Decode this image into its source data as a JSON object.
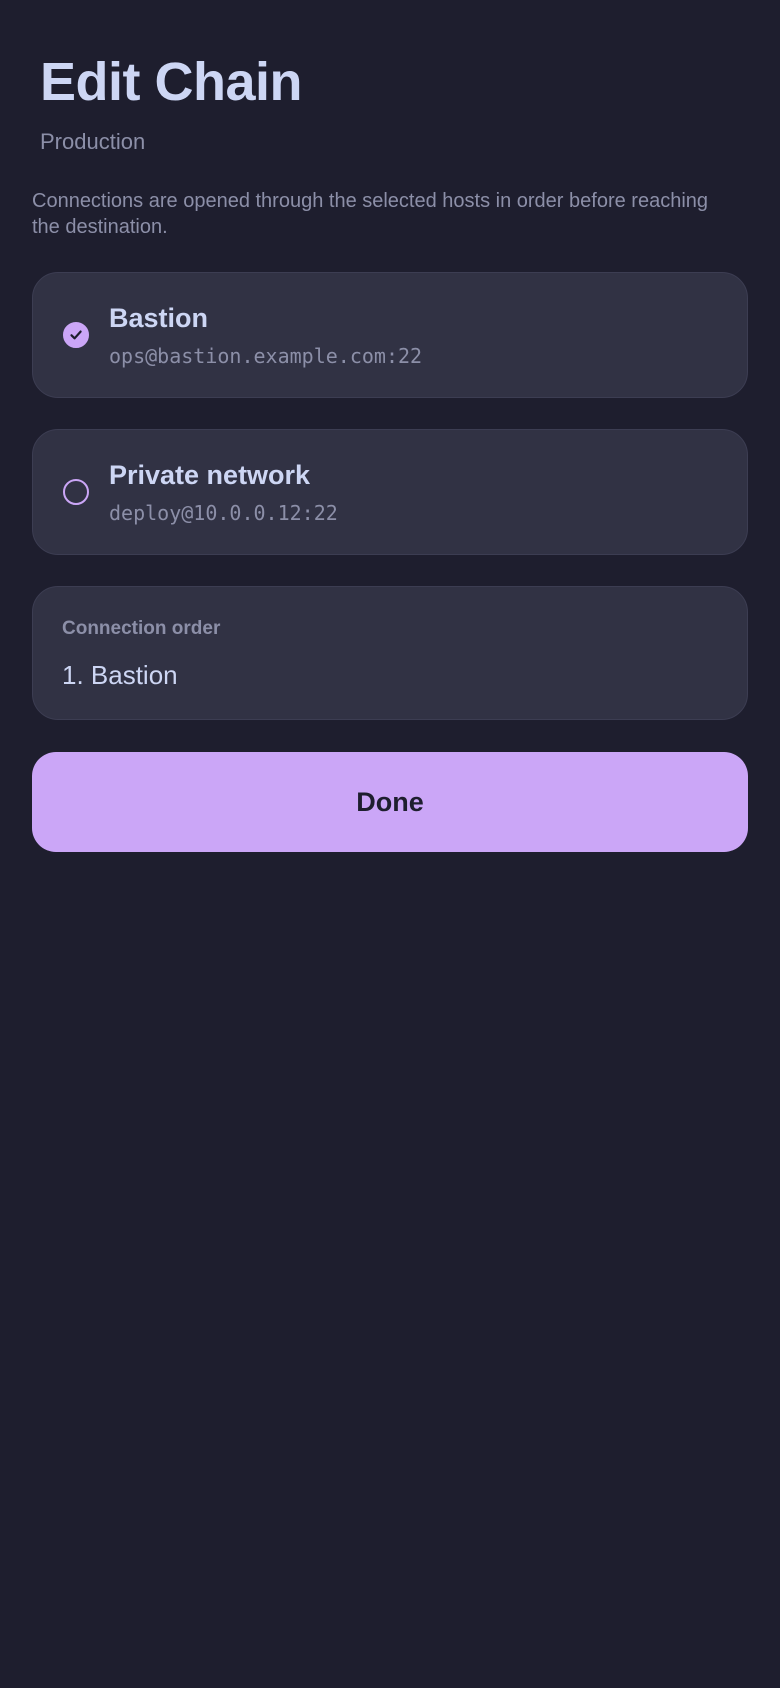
{
  "header": {
    "title": "Edit Chain",
    "subtitle": "Production"
  },
  "description": "Connections are opened through the selected hosts in order before reaching the destination.",
  "hosts": [
    {
      "name": "Bastion",
      "address": "ops@bastion.example.com:22",
      "selected": true
    },
    {
      "name": "Private network",
      "address": "deploy@10.0.0.12:22",
      "selected": false
    }
  ],
  "order": {
    "label": "Connection order",
    "items": [
      "1. Bastion"
    ]
  },
  "done_button": {
    "label": "Done"
  },
  "colors": {
    "background": "#1e1e2e",
    "card": "#313244",
    "accent": "#cba6f7",
    "text_primary": "#cdd6f4",
    "text_secondary": "#8c8fa8"
  },
  "icons": {
    "selected": "check-circle-icon",
    "unselected": "empty-circle-icon"
  }
}
